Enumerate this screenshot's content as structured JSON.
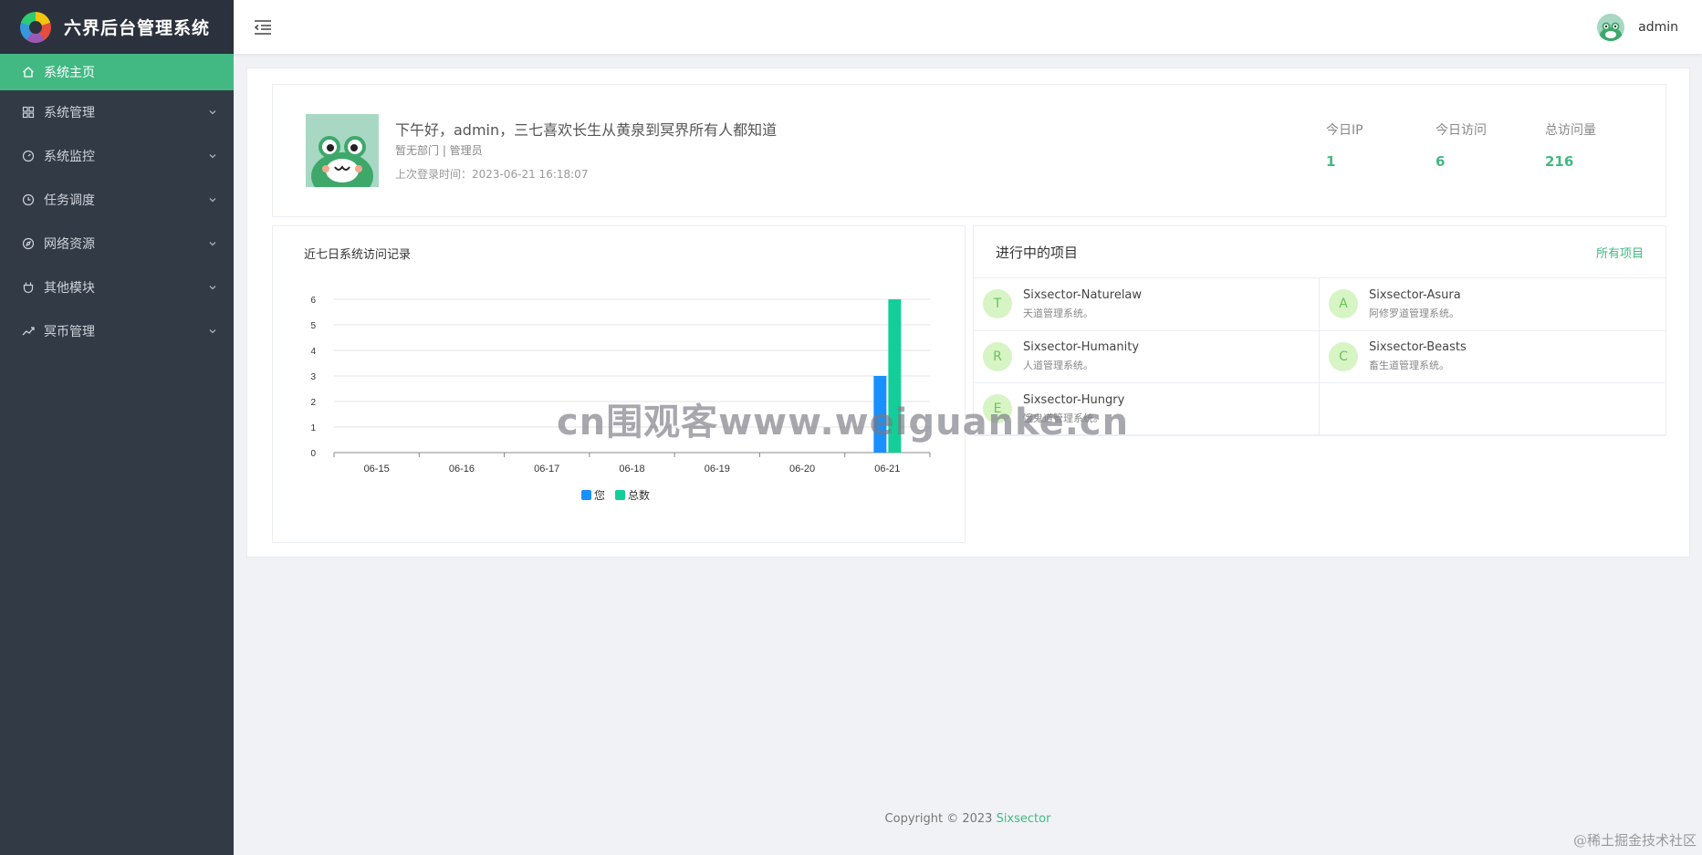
{
  "brand": {
    "title": "六界后台管理系统"
  },
  "sidebar": {
    "items": [
      {
        "label": "系统主页",
        "icon": "home-icon",
        "active": true
      },
      {
        "label": "系统管理",
        "icon": "grid-icon"
      },
      {
        "label": "系统监控",
        "icon": "dashboard-icon"
      },
      {
        "label": "任务调度",
        "icon": "clock-icon"
      },
      {
        "label": "网络资源",
        "icon": "compass-icon"
      },
      {
        "label": "其他模块",
        "icon": "plug-icon"
      },
      {
        "label": "冥币管理",
        "icon": "trend-icon"
      }
    ]
  },
  "header": {
    "username": "admin"
  },
  "welcome": {
    "greeting": "下午好，admin，三七喜欢长生从黄泉到冥界所有人都知道",
    "dept": "暂无部门 | 管理员",
    "last_login": "上次登录时间：2023-06-21 16:18:07",
    "stats": [
      {
        "label": "今日IP",
        "value": "1"
      },
      {
        "label": "今日访问",
        "value": "6"
      },
      {
        "label": "总访问量",
        "value": "216"
      }
    ]
  },
  "chart_data": {
    "type": "bar",
    "title": "近七日系统访问记录",
    "categories": [
      "06-15",
      "06-16",
      "06-17",
      "06-18",
      "06-19",
      "06-20",
      "06-21"
    ],
    "series": [
      {
        "name": "您",
        "values": [
          0,
          0,
          0,
          0,
          0,
          0,
          3
        ],
        "color": "#1890ff"
      },
      {
        "name": "总数",
        "values": [
          0,
          0,
          0,
          0,
          0,
          0,
          6
        ],
        "color": "#13ce99"
      }
    ],
    "ylim": [
      0,
      6
    ],
    "yticks": [
      0,
      1,
      2,
      3,
      4,
      5,
      6
    ],
    "grid": true,
    "legend": "bottom"
  },
  "projects": {
    "title": "进行中的项目",
    "all_link": "所有项目",
    "items": [
      {
        "letter": "T",
        "name": "Sixsector-Naturelaw",
        "desc": "天道管理系统。"
      },
      {
        "letter": "A",
        "name": "Sixsector-Asura",
        "desc": "阿修罗道管理系统。"
      },
      {
        "letter": "R",
        "name": "Sixsector-Humanity",
        "desc": "人道管理系统。"
      },
      {
        "letter": "C",
        "name": "Sixsector-Beasts",
        "desc": "畜生道管理系统。"
      },
      {
        "letter": "E",
        "name": "Sixsector-Hungry",
        "desc": "饿鬼道管理系统。"
      }
    ]
  },
  "footer": {
    "copyright": "Copyright © 2023",
    "link": "Sixsector"
  },
  "watermark": "cn围观客www.weiguanke.cn",
  "corner_mark": "@稀土掘金技术社区"
}
